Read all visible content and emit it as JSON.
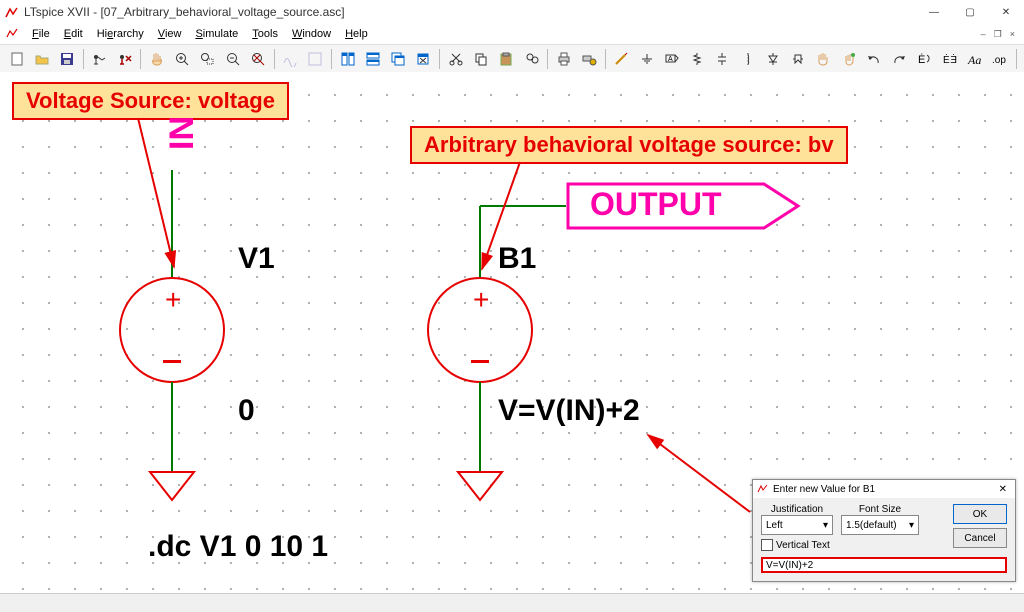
{
  "app": {
    "title": "LTspice XVII - [07_Arbitrary_behavioral_voltage_source.asc]"
  },
  "menu": {
    "file": "File",
    "edit": "Edit",
    "hierarchy": "Hierarchy",
    "view": "View",
    "simulate": "Simulate",
    "tools": "Tools",
    "window": "Window",
    "help": "Help"
  },
  "callouts": {
    "v1": "Voltage Source: voltage",
    "b1": "Arbitrary behavioral voltage source: bv"
  },
  "schematic": {
    "net_in": "IN",
    "net_out": "OUTPUT",
    "v1_name": "V1",
    "v1_value": "0",
    "b1_name": "B1",
    "b1_value": "V=V(IN)+2",
    "directive": ".dc V1 0 10 1"
  },
  "dialog": {
    "title": "Enter new Value for B1",
    "justification_label": "Justification",
    "justification": "Left",
    "fontsize_label": "Font Size",
    "fontsize": "1.5(default)",
    "vertical": "Vertical Text",
    "ok": "OK",
    "cancel": "Cancel",
    "value": "V=V(IN)+2"
  },
  "toolbar_icons": [
    "new-file",
    "open-file",
    "save-file",
    "spacer1",
    "run",
    "halt",
    "spacer2",
    "pan-hand",
    "zoom-in",
    "zoom-rect",
    "zoom-out",
    "zoom-extents",
    "spacer3",
    "autorange",
    "tile",
    "cascade",
    "close-windows",
    "spacer4",
    "cut",
    "copy",
    "paste",
    "find",
    "spacer5",
    "print",
    "setup",
    "spacer6",
    "pencil",
    "wire",
    "ground",
    "label-net",
    "resistor",
    "capacitor",
    "inductor",
    "diode",
    "component",
    "move",
    "drag",
    "undo",
    "redo",
    "rotate",
    "mirror",
    "text",
    "spice-directive"
  ]
}
